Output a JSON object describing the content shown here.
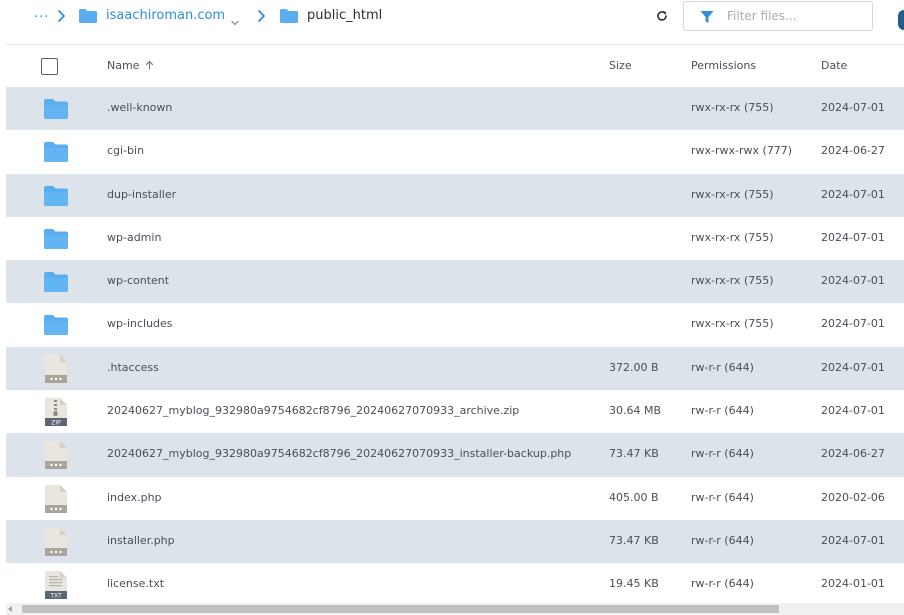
{
  "breadcrumb": {
    "ellipsis": "...",
    "items": [
      {
        "label": "isaachiroman.com",
        "link": true,
        "has_dropdown": true
      },
      {
        "label": "public_html",
        "link": false,
        "has_dropdown": false
      }
    ]
  },
  "toolbar": {
    "refresh_icon": "refresh-icon",
    "filter": {
      "placeholder": "Filter files...",
      "value": "",
      "icon": "filter-icon"
    }
  },
  "columns": {
    "name": "Name",
    "size": "Size",
    "permissions": "Permissions",
    "date": "Date",
    "sort_icon": "arrow-up-icon"
  },
  "files": [
    {
      "name": ".well-known",
      "type": "folder",
      "size": "",
      "permissions": "rwx-rx-rx (755)",
      "date": "2024-07-01"
    },
    {
      "name": "cgi-bin",
      "type": "folder",
      "size": "",
      "permissions": "rwx-rwx-rwx (777)",
      "date": "2024-06-27"
    },
    {
      "name": "dup-installer",
      "type": "folder",
      "size": "",
      "permissions": "rwx-rx-rx (755)",
      "date": "2024-07-01"
    },
    {
      "name": "wp-admin",
      "type": "folder",
      "size": "",
      "permissions": "rwx-rx-rx (755)",
      "date": "2024-07-01"
    },
    {
      "name": "wp-content",
      "type": "folder",
      "size": "",
      "permissions": "rwx-rx-rx (755)",
      "date": "2024-07-01"
    },
    {
      "name": "wp-includes",
      "type": "folder",
      "size": "",
      "permissions": "rwx-rx-rx (755)",
      "date": "2024-07-01"
    },
    {
      "name": ".htaccess",
      "type": "file",
      "size": "372.00 B",
      "permissions": "rw-r-r (644)",
      "date": "2024-07-01"
    },
    {
      "name": "20240627_myblog_932980a9754682cf8796_20240627070933_archive.zip",
      "type": "zip",
      "badge": "ZIP",
      "size": "30.64 MB",
      "permissions": "rw-r-r (644)",
      "date": "2024-07-01"
    },
    {
      "name": "20240627_myblog_932980a9754682cf8796_20240627070933_installer-backup.php",
      "type": "file",
      "size": "73.47 KB",
      "permissions": "rw-r-r (644)",
      "date": "2024-06-27"
    },
    {
      "name": "index.php",
      "type": "file",
      "size": "405.00 B",
      "permissions": "rw-r-r (644)",
      "date": "2020-02-06"
    },
    {
      "name": "installer.php",
      "type": "file",
      "size": "73.47 KB",
      "permissions": "rw-r-r (644)",
      "date": "2024-07-01"
    },
    {
      "name": "license.txt",
      "type": "txt",
      "badge": "TXT",
      "size": "19.45 KB",
      "permissions": "rw-r-r (644)",
      "date": "2024-01-01"
    }
  ],
  "colors": {
    "accent": "#2f8fd8",
    "folder": "#5aaef0",
    "row_shaded": "#dde3ea",
    "file_icon": "#e9e6df"
  }
}
